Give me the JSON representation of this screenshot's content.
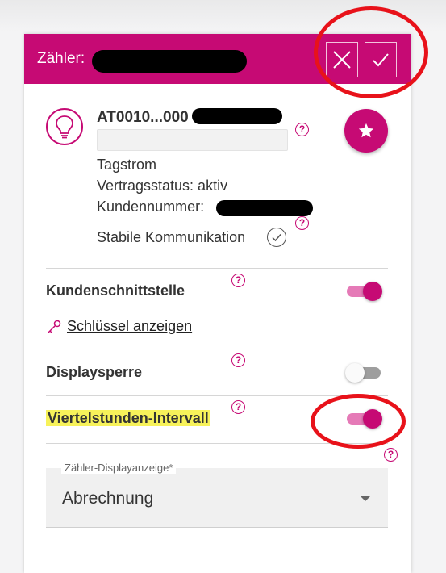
{
  "header": {
    "title": "Zähler:",
    "close_icon": "close-icon",
    "confirm_icon": "check-icon",
    "color": "#c60a74"
  },
  "meter": {
    "icon": "lightbulb-icon",
    "id_prefix": "AT0010...000",
    "tariff": "Tagstrom",
    "contract_status": "Vertragsstatus: aktiv",
    "customer_number_label": "Kundennummer:",
    "communication": "Stabile Kommunikation",
    "favorite_icon": "star-icon"
  },
  "settings": {
    "customer_interface": {
      "label": "Kundenschnittstelle",
      "enabled": true
    },
    "show_key_link": "Schlüssel anzeigen",
    "display_lock": {
      "label": "Displaysperre",
      "enabled": false
    },
    "quarter_hour_interval": {
      "label": "Viertelstunden-Intervall",
      "enabled": true
    },
    "display_select": {
      "label": "Zähler-Displayanzeige*",
      "value": "Abrechnung"
    }
  },
  "help_glyph": "?",
  "colors": {
    "accent": "#c60a74",
    "toggle_track_on": "#e57ab7",
    "annotation": "#e8121a",
    "highlight": "#f7f25a"
  }
}
